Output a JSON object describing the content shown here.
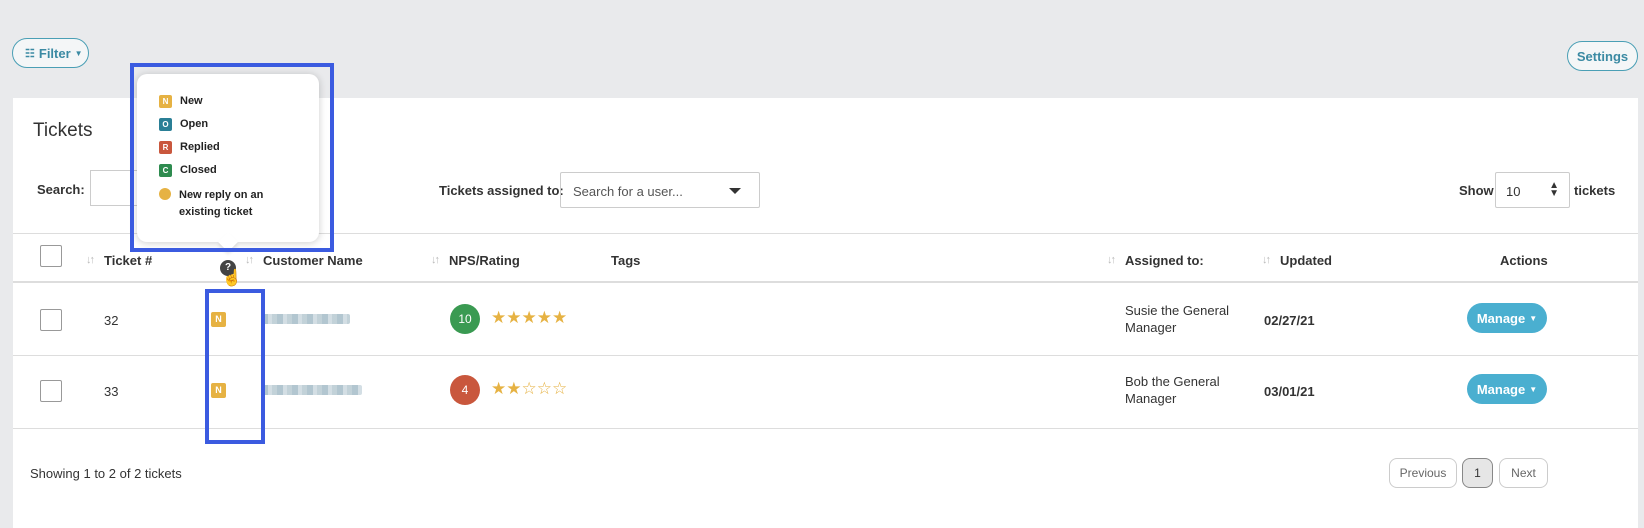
{
  "toolbar": {
    "filter_label": "Filter",
    "settings_label": "Settings"
  },
  "page": {
    "title": "Tickets"
  },
  "controls": {
    "search_label": "Search:",
    "assigned_label": "Tickets assigned to:",
    "assigned_placeholder": "Search for a user...",
    "show_label": "Show",
    "show_value": "10",
    "tickets_label": "tickets"
  },
  "legend": [
    {
      "letter": "N",
      "label": "New",
      "color": "#e6b243"
    },
    {
      "letter": "O",
      "label": "Open",
      "color": "#2a7f96"
    },
    {
      "letter": "R",
      "label": "Replied",
      "color": "#c9573d"
    },
    {
      "letter": "C",
      "label": "Closed",
      "color": "#2e8b4f"
    },
    {
      "label": "New reply on an existing ticket",
      "color": "#e6b243"
    }
  ],
  "table": {
    "headers": {
      "ticket": "Ticket #",
      "customer": "Customer Name",
      "nps": "NPS/Rating",
      "tags": "Tags",
      "assigned": "Assigned to:",
      "updated": "Updated",
      "actions": "Actions"
    },
    "rows": [
      {
        "ticket": "32",
        "status": "N",
        "nps": "10",
        "nps_color": "#3a9a52",
        "stars": 5,
        "assigned": "Susie the General Manager",
        "updated": "02/27/21",
        "action": "Manage"
      },
      {
        "ticket": "33",
        "status": "N",
        "nps": "4",
        "nps_color": "#c9573d",
        "stars": 2,
        "assigned": "Bob the General Manager",
        "updated": "03/01/21",
        "action": "Manage"
      }
    ]
  },
  "footer": {
    "showing": "Showing 1 to 2 of 2 tickets",
    "previous": "Previous",
    "page": "1",
    "next": "Next"
  }
}
